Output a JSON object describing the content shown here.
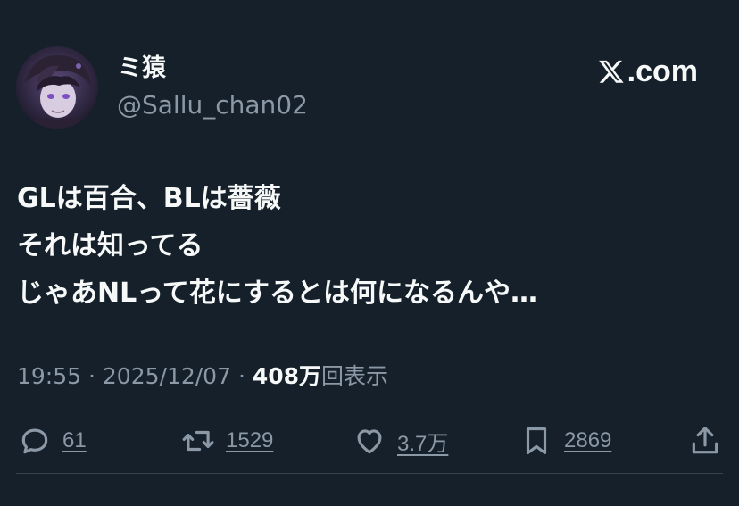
{
  "user": {
    "display_name": "ミ猿",
    "handle": "@Sallu_chan02",
    "avatar": "anime-character-avatar"
  },
  "site": {
    "logo": "x-logo-icon",
    "label": ".com"
  },
  "tweet": {
    "lines": [
      "GLは百合、BLは薔薇",
      "それは知ってる",
      "じゃあNLって花にするとは何になるんや…"
    ]
  },
  "meta": {
    "time": "19:55",
    "separator": "·",
    "date": "2025/12/07",
    "views_count": "408万",
    "views_label": "回表示"
  },
  "actions": {
    "replies": {
      "icon": "reply-icon",
      "count": "61"
    },
    "reposts": {
      "icon": "repost-icon",
      "count": "1529"
    },
    "likes": {
      "icon": "heart-icon",
      "count": "3.7万"
    },
    "bookmarks": {
      "icon": "bookmark-icon",
      "count": "2869"
    },
    "share": {
      "icon": "share-icon"
    }
  },
  "colors": {
    "background": "#15202b",
    "primary_text": "#f7f9f9",
    "secondary_text": "#8b98a5"
  }
}
